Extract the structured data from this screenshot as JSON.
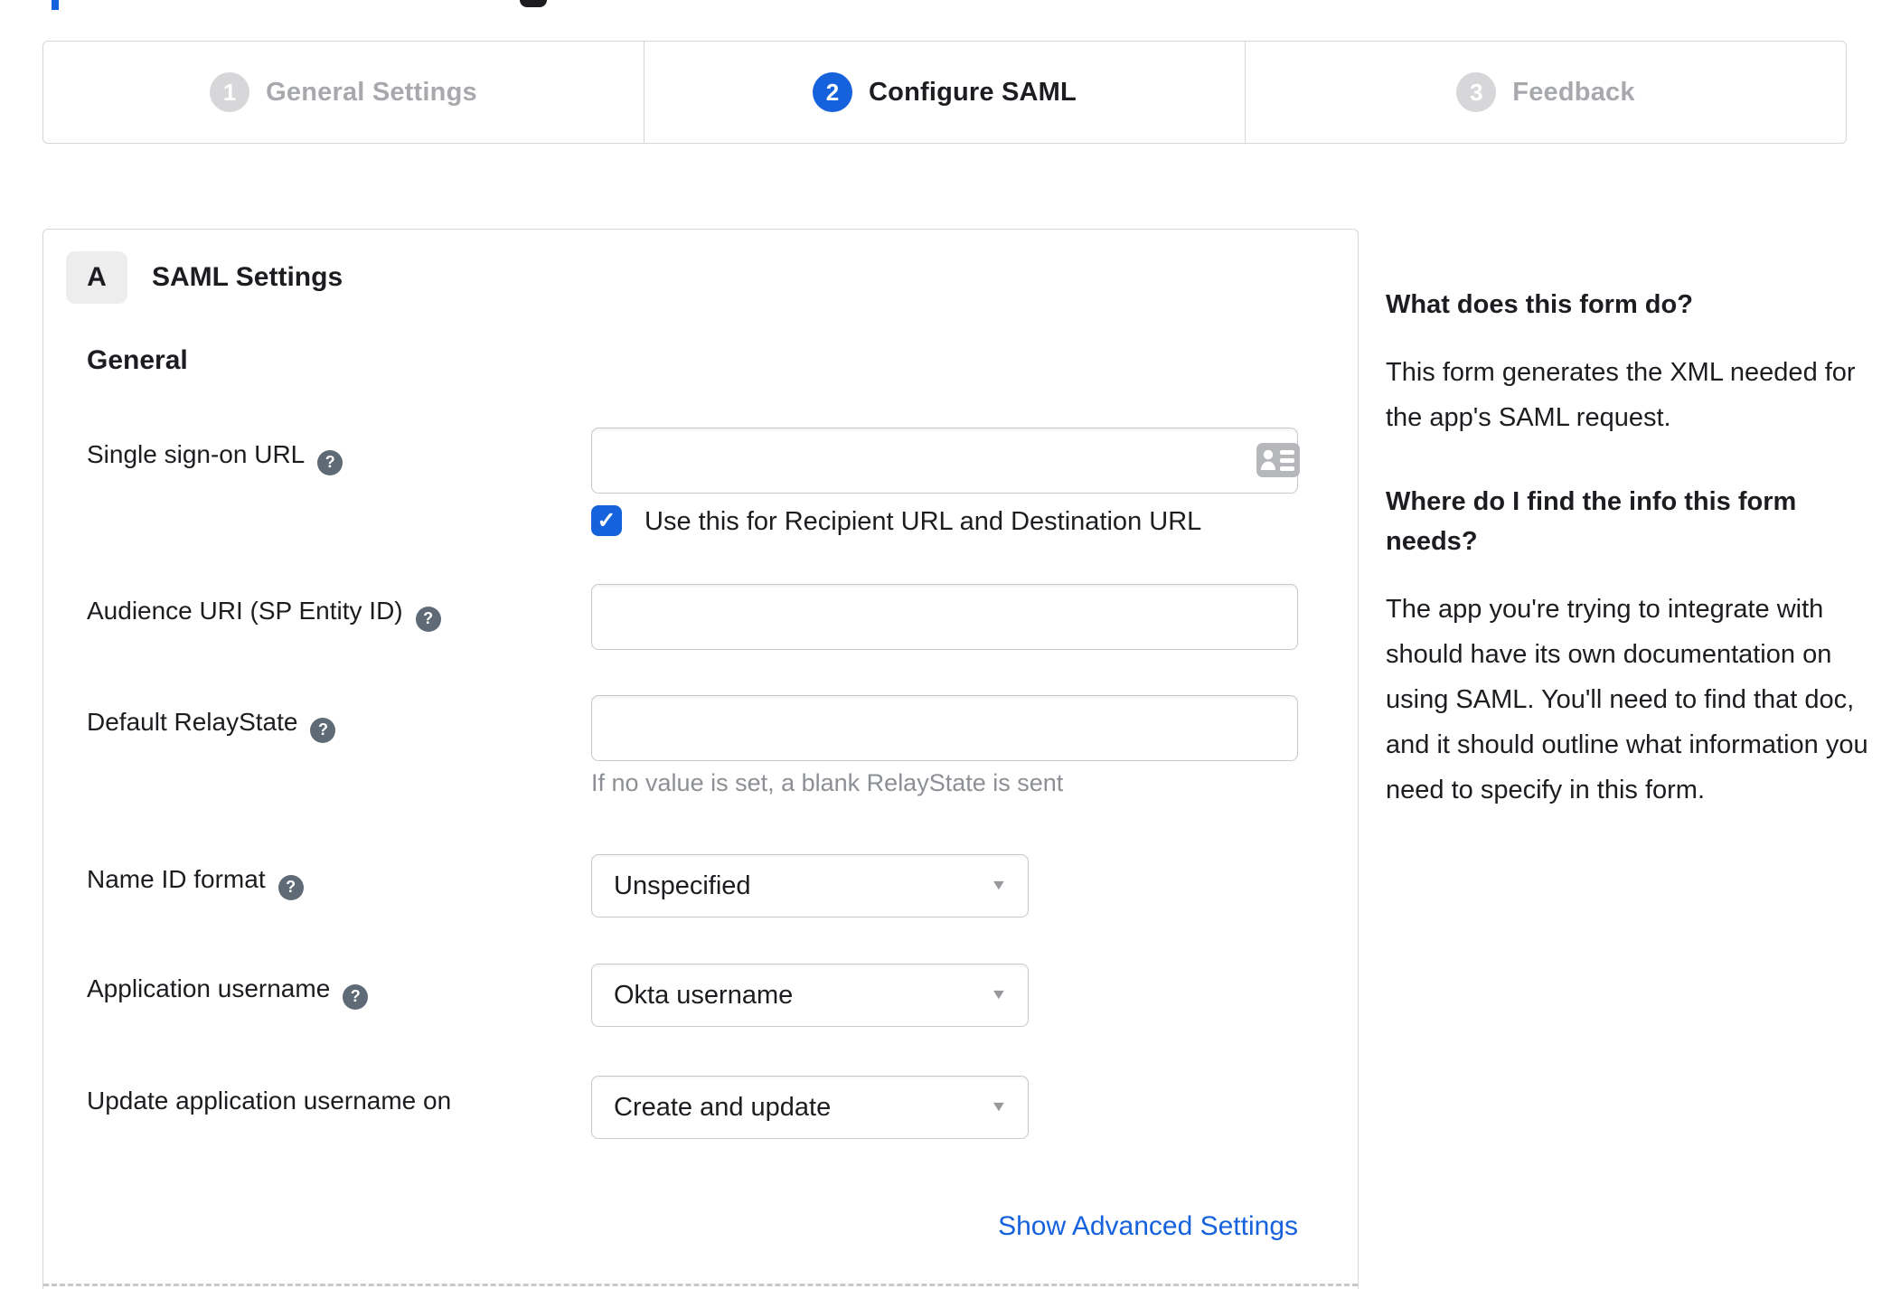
{
  "colors": {
    "accent_blue": "#1662dd",
    "text_dark": "#1d1d21",
    "inactive_gray": "#a7a9ac",
    "border_gray": "#d7d7da",
    "hint_gray": "#8c8f94",
    "help_badge_gray": "#5e6a75"
  },
  "icons": {
    "help_glyph": "?",
    "caret_glyph": "▼",
    "check_glyph": "✓"
  },
  "stepper": {
    "steps": [
      {
        "number": "1",
        "label": "General Settings",
        "state": "inactive"
      },
      {
        "number": "2",
        "label": "Configure SAML",
        "state": "active"
      },
      {
        "number": "3",
        "label": "Feedback",
        "state": "inactive"
      }
    ]
  },
  "panel": {
    "section_badge": "A",
    "title": "SAML Settings",
    "subsection_title": "General",
    "advanced_link_label": "Show Advanced Settings"
  },
  "form": {
    "sso": {
      "label": "Single sign-on URL",
      "value": "",
      "checkbox_label": "Use this for Recipient URL and Destination URL",
      "checkbox_checked": true
    },
    "audience": {
      "label": "Audience URI (SP Entity ID)",
      "value": ""
    },
    "relay_state": {
      "label": "Default RelayState",
      "value": "",
      "hint": "If no value is set, a blank RelayState is sent"
    },
    "name_id_format": {
      "label": "Name ID format",
      "value": "Unspecified"
    },
    "application_username": {
      "label": "Application username",
      "value": "Okta username"
    },
    "update_application_username_on": {
      "label": "Update application username on",
      "value": "Create and update"
    }
  },
  "sidebar": {
    "sections": [
      {
        "heading": "What does this form do?",
        "body": "This form generates the XML needed for the app's SAML request."
      },
      {
        "heading": "Where do I find the info this form needs?",
        "body": "The app you're trying to integrate with should have its own documentation on using SAML. You'll need to find that doc, and it should outline what information you need to specify in this form."
      }
    ]
  }
}
